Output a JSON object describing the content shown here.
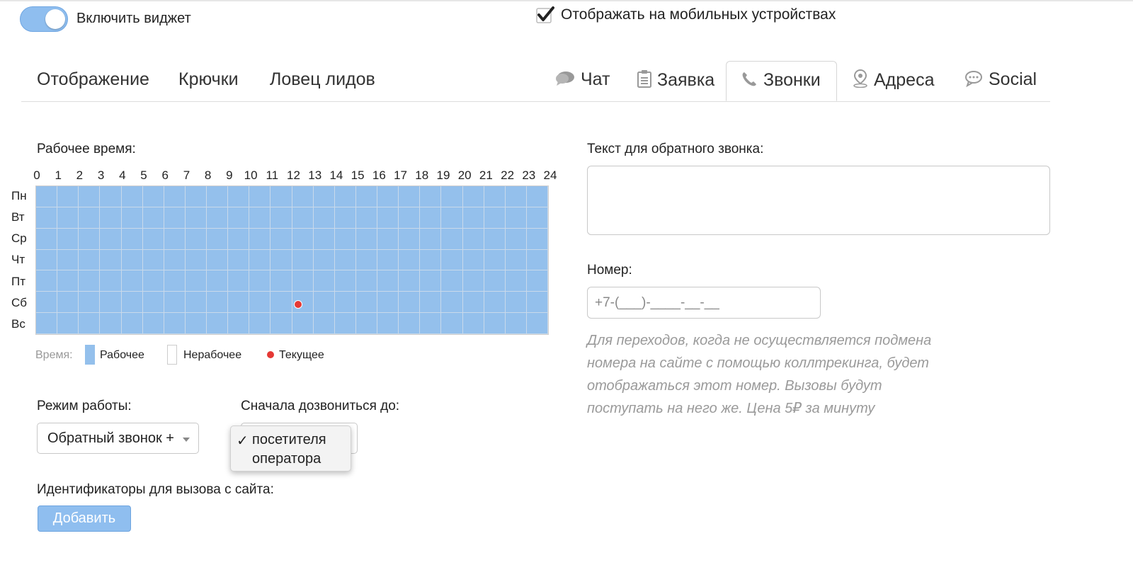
{
  "header": {
    "enable_widget_label": "Включить виджет",
    "enable_widget_on": true,
    "mobile_label": "Отображать на мобильных устройствах",
    "mobile_checked": true
  },
  "tabs_left": [
    {
      "label": "Отображение"
    },
    {
      "label": "Крючки"
    },
    {
      "label": "Ловец лидов"
    }
  ],
  "tabs_right": [
    {
      "label": "Чат",
      "icon": "chat-bubble-icon"
    },
    {
      "label": "Заявка",
      "icon": "clipboard-icon"
    },
    {
      "label": "Звонки",
      "icon": "phone-icon",
      "active": true
    },
    {
      "label": "Адреса",
      "icon": "map-pin-icon"
    },
    {
      "label": "Social",
      "icon": "speech-bubble-icon"
    }
  ],
  "schedule": {
    "label": "Рабочее время:",
    "hours": [
      "0",
      "1",
      "2",
      "3",
      "4",
      "5",
      "6",
      "7",
      "8",
      "9",
      "10",
      "11",
      "12",
      "13",
      "14",
      "15",
      "16",
      "17",
      "18",
      "19",
      "20",
      "21",
      "22",
      "23",
      "24"
    ],
    "days": [
      "Пн",
      "Вт",
      "Ср",
      "Чт",
      "Пт",
      "Сб",
      "Вс"
    ],
    "current": {
      "day": "Сб",
      "hour": 12
    },
    "legend": {
      "title": "Время:",
      "working": "Рабочее",
      "non_working": "Нерабочее",
      "current": "Текущее"
    },
    "colors": {
      "working": "#94c0ec",
      "non_working": "#ffffff",
      "current": "#e53935"
    }
  },
  "mode": {
    "label": "Режим работы:",
    "selected": "Обратный звонок +"
  },
  "call_first": {
    "label": "Сначала дозвониться до:",
    "options": [
      "посетителя",
      "оператора"
    ],
    "selected_index": 0
  },
  "identifiers": {
    "label": "Идентификаторы для вызова с сайта:",
    "add_button": "Добавить"
  },
  "callback_text": {
    "label": "Текст для обратного звонка:",
    "value": ""
  },
  "number": {
    "label": "Номер:",
    "placeholder": "+7-(___)-____-__-__",
    "hint": "Для переходов, когда не осуществляется подмена номера на сайте с помощью коллтрекинга, будет отображаться этот номер. Вызовы будут поступать на него же. Цена 5₽ за минуту"
  },
  "accent_color": "#8fbeef"
}
